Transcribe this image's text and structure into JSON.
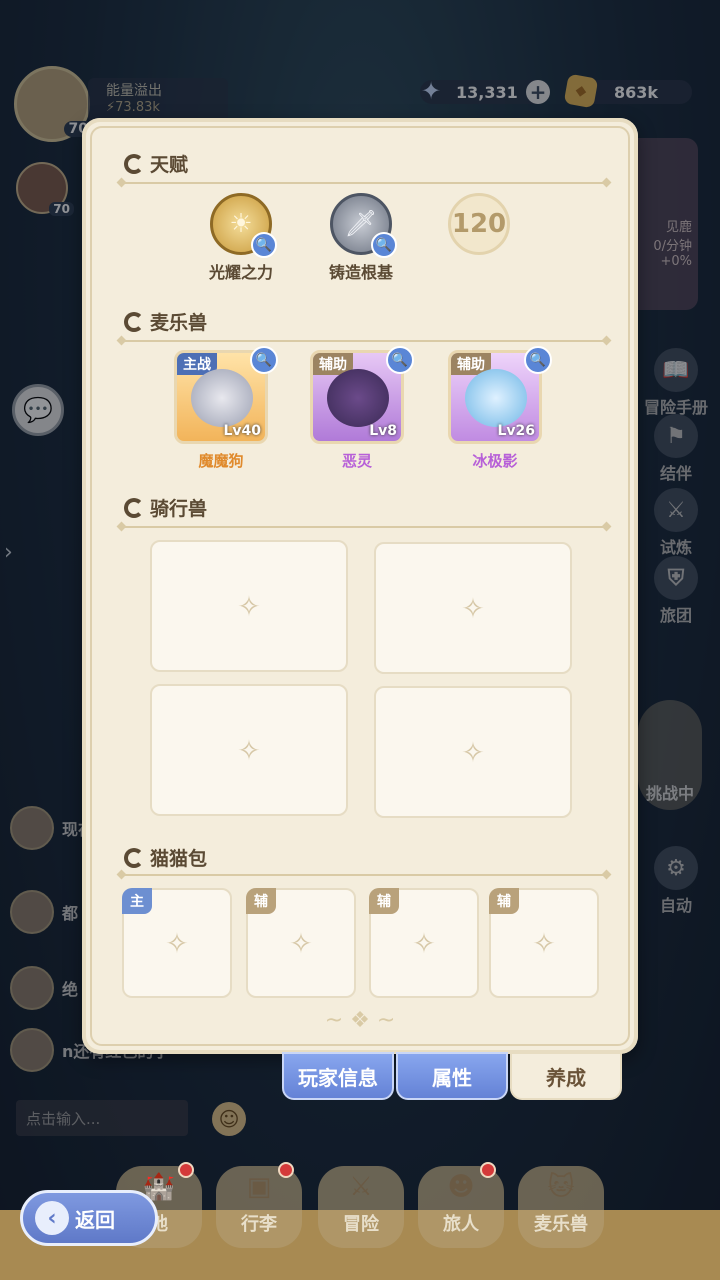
{
  "top": {
    "status_title": "能量溢出",
    "status_value": "73.83k",
    "player_level": "70",
    "companion_level": "70"
  },
  "currency": {
    "stars": "13,331",
    "gold": "863k"
  },
  "right_menu": {
    "card_line1": "见鹿",
    "card_line2": "0/分钟",
    "card_line3": "+0%",
    "items": [
      "冒险手册",
      "结伴",
      "试炼",
      "旅团"
    ],
    "fight_label": "挑战中",
    "auto_label": "自动"
  },
  "chat": {
    "line1": "现在",
    "line2": "都",
    "line3": "绝",
    "line4": "n还有红色的字",
    "input_placeholder": "点击输入..."
  },
  "panel": {
    "talent_title": "天赋",
    "talents": [
      {
        "name": "光耀之力",
        "icon": "sun-emblem"
      },
      {
        "name": "铸造根基",
        "icon": "sword-emblem"
      },
      {
        "name": "",
        "icon": "locked-120",
        "unlock_level": "120"
      }
    ],
    "pet_title": "麦乐兽",
    "pets": [
      {
        "role": "主战",
        "name": "魔魔狗",
        "level": "Lv40"
      },
      {
        "role": "辅助",
        "name": "恶灵",
        "level": "Lv8"
      },
      {
        "role": "辅助",
        "name": "冰极影",
        "level": "Lv26"
      }
    ],
    "mount_title": "骑行兽",
    "bag_title": "猫猫包",
    "bag_tags": [
      "主",
      "辅",
      "辅",
      "辅"
    ]
  },
  "tabs": [
    "玩家信息",
    "属性",
    "养成"
  ],
  "bottom_nav": [
    "地",
    "行李",
    "冒险",
    "旅人",
    "麦乐兽"
  ],
  "back_label": "返回",
  "colors": {
    "panel_bg": "#f4eddc",
    "accent_blue": "#6482d6",
    "text_brown": "#5b4a34",
    "pet_main_name": "#e08a2c",
    "pet_sub_name": "#b760d8"
  }
}
